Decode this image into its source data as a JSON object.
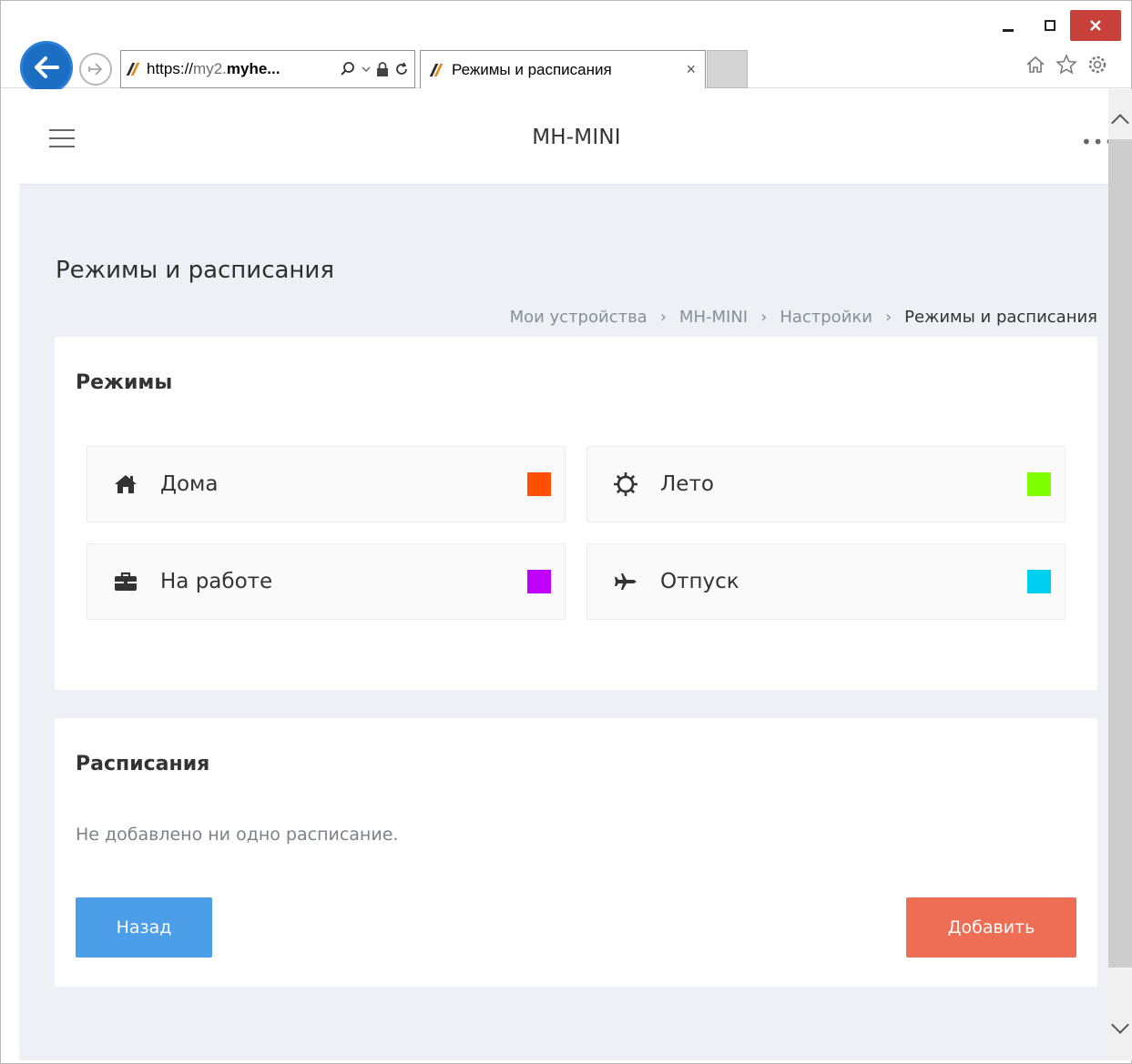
{
  "browser": {
    "url_parts": {
      "scheme": "https://",
      "sub": "my2.",
      "domain": "myhe..."
    },
    "tab_title": "Режимы и расписания",
    "tab_close": "×"
  },
  "app": {
    "title": "MH-MINI",
    "more": "•••"
  },
  "page": {
    "title": "Режимы и расписания",
    "breadcrumb": {
      "items": [
        "Мои устройства",
        "MH-MINI",
        "Настройки"
      ],
      "current": "Режимы и расписания",
      "separator": "›"
    }
  },
  "modes_card": {
    "title": "Режимы",
    "modes": [
      {
        "label": "Дома",
        "icon": "home-icon",
        "color": "#ff5000"
      },
      {
        "label": "Лето",
        "icon": "sun-icon",
        "color": "#80ff00"
      },
      {
        "label": "На работе",
        "icon": "briefcase-icon",
        "color": "#c000ff"
      },
      {
        "label": "Отпуск",
        "icon": "plane-icon",
        "color": "#00d0f0"
      }
    ]
  },
  "schedules_card": {
    "title": "Расписания",
    "empty_text": "Не добавлено ни одно расписание.",
    "back_label": "Назад",
    "add_label": "Добавить"
  },
  "colors": {
    "back_button": "#4c9ee8",
    "add_button": "#ee6d55",
    "page_bg": "#edf0f4"
  }
}
